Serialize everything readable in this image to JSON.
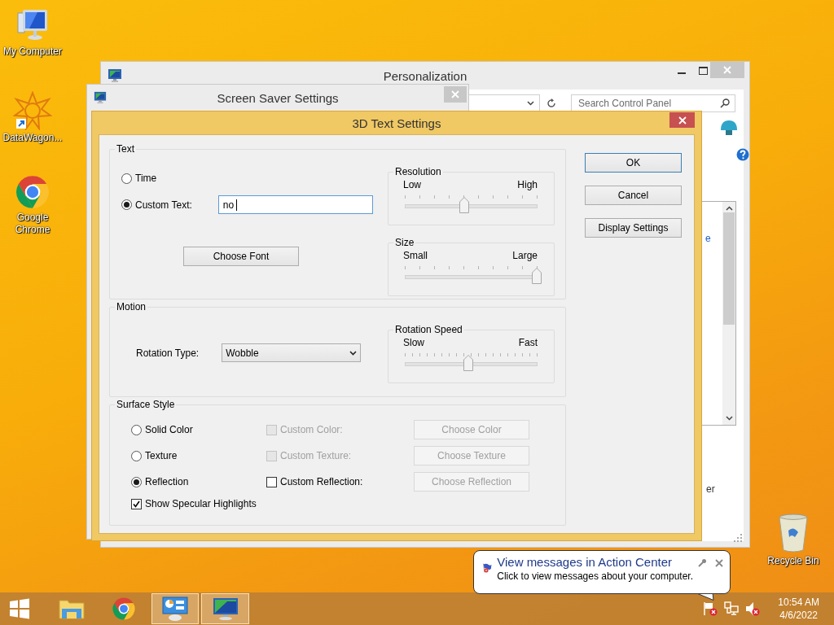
{
  "desktop_icons": [
    {
      "kind": "computer",
      "label": "My Computer"
    },
    {
      "kind": "app",
      "label": "DataWagon..."
    },
    {
      "kind": "chrome",
      "label": "Google Chrome"
    },
    {
      "kind": "recycle",
      "label": "Recycle Bin"
    }
  ],
  "personalization": {
    "title": "Personalization",
    "search_placeholder": "Search Control Panel",
    "fragments": [
      "e",
      "er"
    ]
  },
  "screen_saver": {
    "title": "Screen Saver Settings"
  },
  "dialog": {
    "title": "3D Text Settings",
    "text_group": {
      "title": "Text",
      "options": [
        {
          "label": "Time",
          "selected": false
        },
        {
          "label": "Custom Text:",
          "selected": true
        }
      ],
      "custom_text": "no",
      "font_button": "Choose Font",
      "sliders": [
        {
          "title": "Resolution",
          "min_label": "Low",
          "max_label": "High",
          "level": 0.45
        },
        {
          "title": "Size",
          "min_label": "Small",
          "max_label": "Large",
          "level": 1
        }
      ]
    },
    "motion_group": {
      "title": "Motion",
      "rotation_label": "Rotation Type:",
      "rotation_value": "Wobble",
      "slider": {
        "title": "Rotation Speed",
        "min_label": "Slow",
        "max_label": "Fast",
        "level": 0.48
      }
    },
    "surface_group": {
      "title": "Surface Style",
      "rows": [
        {
          "label": "Solid Color",
          "selected": false,
          "custom_label": "Custom Color:",
          "custom_checked": false,
          "custom_disabled": true,
          "button": "Choose Color",
          "button_disabled": true
        },
        {
          "label": "Texture",
          "selected": false,
          "custom_label": "Custom Texture:",
          "custom_checked": false,
          "custom_disabled": true,
          "button": "Choose Texture",
          "button_disabled": true
        },
        {
          "label": "Reflection",
          "selected": true,
          "custom_label": "Custom Reflection:",
          "custom_checked": false,
          "custom_disabled": false,
          "button": "Choose Reflection",
          "button_disabled": true
        }
      ],
      "highlights": {
        "label": "Show Specular Highlights",
        "checked": true
      }
    },
    "buttons": [
      {
        "label": "OK",
        "default": true
      },
      {
        "label": "Cancel",
        "default": false
      },
      {
        "label": "Display Settings",
        "default": false
      }
    ]
  },
  "notification": {
    "title": "View messages in Action Center",
    "message": "Click to view messages about your computer."
  },
  "taskbar": {
    "items": [
      {
        "kind": "start",
        "active": false
      },
      {
        "kind": "explorer",
        "active": false
      },
      {
        "kind": "chrome",
        "active": false
      },
      {
        "kind": "control-panel",
        "active": true
      },
      {
        "kind": "screensaver",
        "active": true
      }
    ],
    "time": "10:54 AM",
    "date": "4/6/2022"
  }
}
